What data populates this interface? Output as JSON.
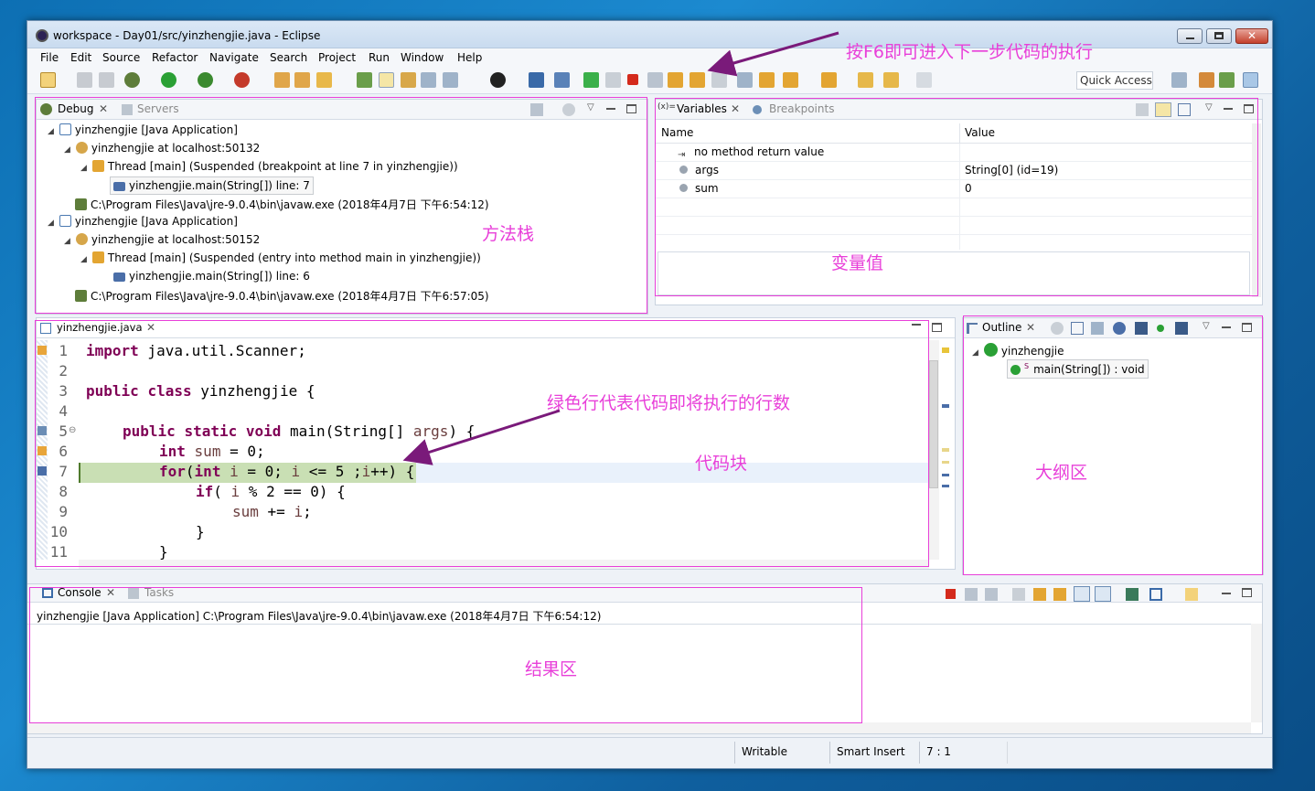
{
  "window": {
    "title": "workspace - Day01/src/yinzhengjie.java - Eclipse"
  },
  "menu": [
    "File",
    "Edit",
    "Source",
    "Refactor",
    "Navigate",
    "Search",
    "Project",
    "Run",
    "Window",
    "Help"
  ],
  "toolbar": {
    "quick_access": "Quick Access"
  },
  "debug": {
    "tab_debug": "Debug",
    "tab_servers": "Servers",
    "tree": [
      "yinzhengjie [Java Application]",
      "yinzhengjie at localhost:50132",
      "Thread [main] (Suspended (breakpoint at line 7 in yinzhengjie))",
      "yinzhengjie.main(String[]) line: 7",
      "C:\\Program Files\\Java\\jre-9.0.4\\bin\\javaw.exe (2018年4月7日 下午6:54:12)",
      "yinzhengjie [Java Application]",
      "yinzhengjie at localhost:50152",
      "Thread [main] (Suspended (entry into method main in yinzhengjie))",
      "yinzhengjie.main(String[]) line: 6",
      "C:\\Program Files\\Java\\jre-9.0.4\\bin\\javaw.exe (2018年4月7日 下午6:57:05)"
    ]
  },
  "variables": {
    "tab_variables": "Variables",
    "tab_breakpoints": "Breakpoints",
    "col_name": "Name",
    "col_value": "Value",
    "rows": [
      {
        "name": "no method return value",
        "value": ""
      },
      {
        "name": "args",
        "value": "String[0]  (id=19)"
      },
      {
        "name": "sum",
        "value": "0"
      }
    ]
  },
  "editor": {
    "tab": "yinzhengjie.java",
    "line_numbers": [
      "1",
      "2",
      "3",
      "4",
      "5",
      "6",
      "7",
      "8",
      "9",
      "10",
      "11"
    ]
  },
  "outline": {
    "tab": "Outline",
    "class": "yinzhengjie",
    "method": "main(String[]) : void",
    "static_mark": "S"
  },
  "console": {
    "tab_console": "Console",
    "tab_tasks": "Tasks",
    "header": "yinzhengjie [Java Application] C:\\Program Files\\Java\\jre-9.0.4\\bin\\javaw.exe (2018年4月7日 下午6:54:12)"
  },
  "status": {
    "writable": "Writable",
    "insert": "Smart Insert",
    "position": "7 : 1"
  },
  "annotations": {
    "f6": "按F6即可进入下一步代码的执行",
    "stack": "方法栈",
    "vars": "变量值",
    "green": "绿色行代表代码即将执行的行数",
    "code": "代码块",
    "outline": "大纲区",
    "result": "结果区"
  },
  "colors": {
    "annotation": "#e83fd9",
    "keyword": "#7f0055",
    "current_line": "#c9dfb4",
    "arrow": "#7a1a7a"
  }
}
